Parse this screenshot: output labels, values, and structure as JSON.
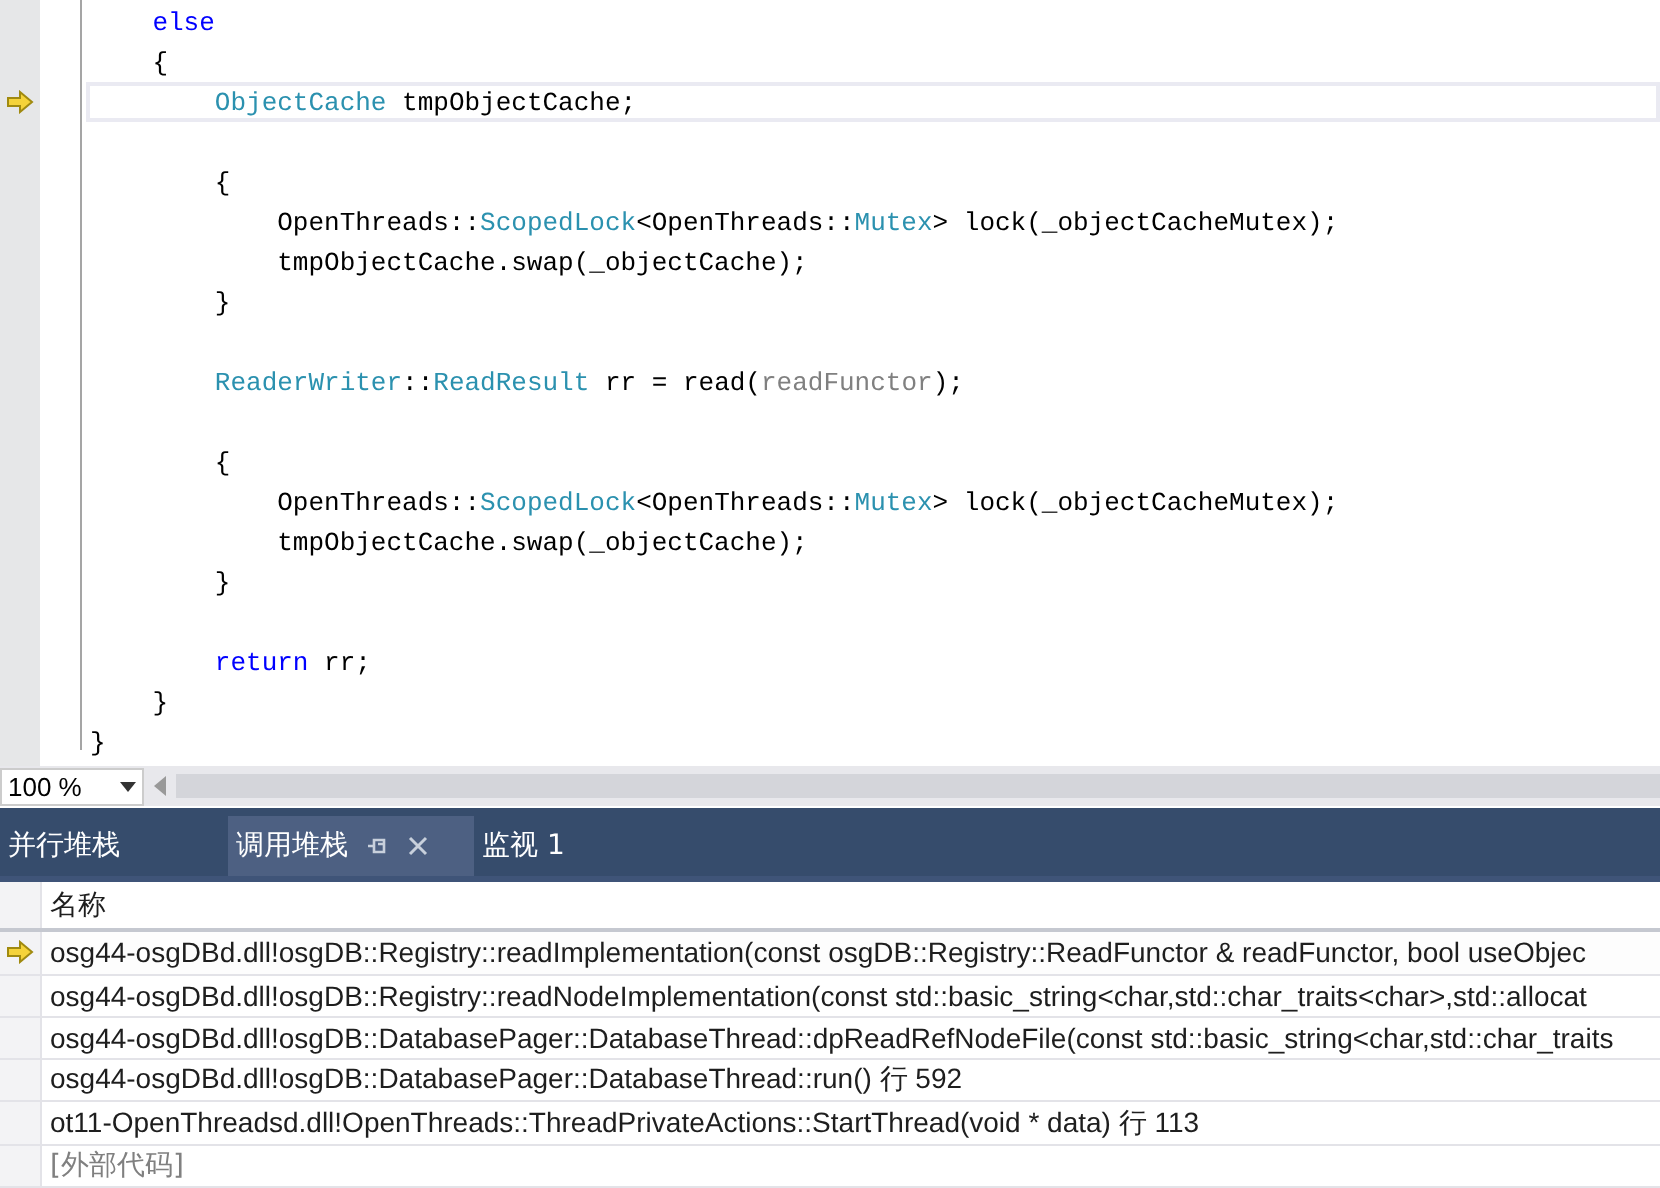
{
  "editor": {
    "lines": [
      {
        "current": false,
        "tokens": [
          {
            "kind": "keyword",
            "text": "    else"
          }
        ]
      },
      {
        "current": false,
        "tokens": [
          {
            "kind": "plain",
            "text": "    {"
          }
        ]
      },
      {
        "current": true,
        "tokens": [
          {
            "kind": "type",
            "text": "        ObjectCache"
          },
          {
            "kind": "plain",
            "text": " tmpObjectCache;"
          }
        ]
      },
      {
        "current": false
      },
      {
        "current": false,
        "tokens": [
          {
            "kind": "plain",
            "text": "        {"
          }
        ]
      },
      {
        "current": false,
        "tokens": [
          {
            "kind": "plain",
            "text": "            OpenThreads::"
          },
          {
            "kind": "type",
            "text": "ScopedLock"
          },
          {
            "kind": "plain",
            "text": "<OpenThreads::"
          },
          {
            "kind": "type",
            "text": "Mutex"
          },
          {
            "kind": "plain",
            "text": "> lock(_objectCacheMutex);"
          }
        ]
      },
      {
        "current": false,
        "tokens": [
          {
            "kind": "plain",
            "text": "            tmpObjectCache.swap(_objectCache);"
          }
        ]
      },
      {
        "current": false,
        "tokens": [
          {
            "kind": "plain",
            "text": "        }"
          }
        ]
      },
      {
        "current": false
      },
      {
        "current": false,
        "tokens": [
          {
            "kind": "type",
            "text": "        ReaderWriter"
          },
          {
            "kind": "plain",
            "text": "::"
          },
          {
            "kind": "type",
            "text": "ReadResult"
          },
          {
            "kind": "plain",
            "text": " rr = read("
          },
          {
            "kind": "param",
            "text": "readFunctor"
          },
          {
            "kind": "plain",
            "text": ");"
          }
        ]
      },
      {
        "current": false
      },
      {
        "current": false,
        "tokens": [
          {
            "kind": "plain",
            "text": "        {"
          }
        ]
      },
      {
        "current": false,
        "tokens": [
          {
            "kind": "plain",
            "text": "            OpenThreads::"
          },
          {
            "kind": "type",
            "text": "ScopedLock"
          },
          {
            "kind": "plain",
            "text": "<OpenThreads::"
          },
          {
            "kind": "type",
            "text": "Mutex"
          },
          {
            "kind": "plain",
            "text": "> lock(_objectCacheMutex);"
          }
        ]
      },
      {
        "current": false,
        "tokens": [
          {
            "kind": "plain",
            "text": "            tmpObjectCache.swap(_objectCache);"
          }
        ]
      },
      {
        "current": false,
        "tokens": [
          {
            "kind": "plain",
            "text": "        }"
          }
        ]
      },
      {
        "current": false
      },
      {
        "current": false,
        "tokens": [
          {
            "kind": "keyword",
            "text": "        return"
          },
          {
            "kind": "plain",
            "text": " rr;"
          }
        ]
      },
      {
        "current": false,
        "tokens": [
          {
            "kind": "plain",
            "text": "    }"
          }
        ]
      },
      {
        "current": false,
        "tokens": [
          {
            "kind": "plain",
            "text": "}"
          }
        ]
      }
    ],
    "zoom": "100 %"
  },
  "tabs": [
    {
      "label": "并行堆栈",
      "selected": false
    },
    {
      "label": "调用堆栈",
      "selected": true
    },
    {
      "label": "监视 1",
      "selected": false
    }
  ],
  "call_stack": {
    "columns": [
      "名称"
    ],
    "rows": [
      {
        "current": true,
        "kind": "frame",
        "text": "osg44-osgDBd.dll!osgDB::Registry::readImplementation(const osgDB::Registry::ReadFunctor & readFunctor, bool useObjec"
      },
      {
        "current": false,
        "kind": "frame",
        "text": "osg44-osgDBd.dll!osgDB::Registry::readNodeImplementation(const std::basic_string<char,std::char_traits<char>,std::allocat"
      },
      {
        "current": false,
        "kind": "frame",
        "text": "osg44-osgDBd.dll!osgDB::DatabasePager::DatabaseThread::dpReadRefNodeFile(const std::basic_string<char,std::char_traits"
      },
      {
        "current": false,
        "kind": "frame",
        "text": "osg44-osgDBd.dll!osgDB::DatabasePager::DatabaseThread::run() 行 592"
      },
      {
        "current": false,
        "kind": "frame",
        "text": "ot11-OpenThreadsd.dll!OpenThreads::ThreadPrivateActions::StartThread(void * data) 行 113"
      },
      {
        "current": false,
        "kind": "external",
        "text": "[外部代码]"
      }
    ]
  }
}
